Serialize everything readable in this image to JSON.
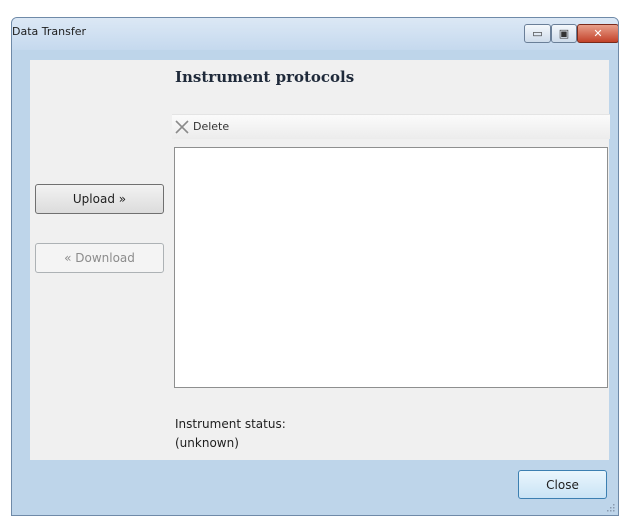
{
  "window": {
    "title": "Data Transfer",
    "controls": {
      "minimize_icon": "minimize-icon",
      "maximize_icon": "maximize-icon",
      "close_icon": "close-icon",
      "minimize_glyph": "▭",
      "maximize_glyph": "▣",
      "close_glyph": "✕"
    }
  },
  "main": {
    "heading": "Instrument protocols",
    "toolbar": {
      "delete_label": "Delete",
      "delete_icon": "delete-x-icon"
    },
    "protocol_list": []
  },
  "sidebar": {
    "upload_label": "Upload »",
    "download_label": "« Download",
    "download_enabled": false
  },
  "status": {
    "label": "Instrument status:",
    "value": "(unknown)"
  },
  "footer": {
    "close_label": "Close"
  },
  "colors": {
    "frame": "#bed5ea",
    "client": "#f0f0f0",
    "close_button_red": "#c3422a"
  }
}
